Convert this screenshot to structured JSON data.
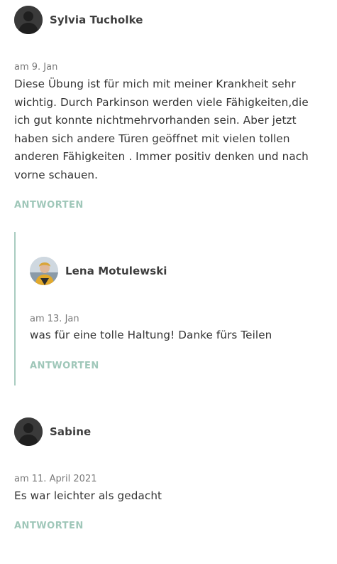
{
  "comments": [
    {
      "author": "Sylvia Tucholke",
      "date": "am 9. Jan",
      "text_lines": [
        "Diese Übung ist für mich mit meiner Krankheit sehr",
        "wichtig. Durch Parkinson werden viele Fähigkeiten,die",
        "ich gut konnte nichtmehrvorhanden sein. Aber jetzt",
        "haben sich andere Türen geöffnet mit vielen tollen",
        "anderen Fähigkeiten . Immer positiv denken und nach",
        "vorne schauen."
      ],
      "reply_label": "ANTWORTEN"
    },
    {
      "author": "Lena Motulewski",
      "date": "am 13. Jan",
      "text": "was für eine tolle Haltung! Danke fürs Teilen",
      "reply_label": "ANTWORTEN"
    },
    {
      "author": "Sabine",
      "date": "am 11. April 2021",
      "text": "Es war leichter als gedacht",
      "reply_label": "ANTWORTEN"
    }
  ],
  "colors": {
    "reply_link": "#9fc7b9",
    "reply_border": "#a9ccc0",
    "avatar_default": "#3a3a3a"
  }
}
